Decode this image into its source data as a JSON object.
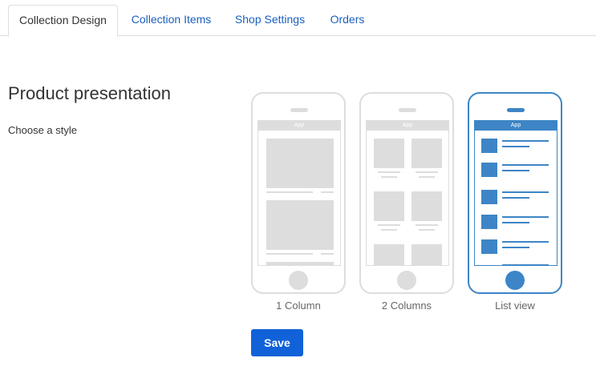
{
  "tabs": [
    {
      "label": "Collection Design",
      "active": true
    },
    {
      "label": "Collection Items",
      "active": false
    },
    {
      "label": "Shop Settings",
      "active": false
    },
    {
      "label": "Orders",
      "active": false
    }
  ],
  "section": {
    "title": "Product presentation",
    "subtitle": "Choose a style"
  },
  "styles": {
    "selected": "List view",
    "options": [
      {
        "label": "1 Column",
        "app_label": "App",
        "selected": false
      },
      {
        "label": "2 Columns",
        "app_label": "App",
        "selected": false
      },
      {
        "label": "List view",
        "app_label": "App",
        "selected": true
      }
    ]
  },
  "actions": {
    "save_label": "Save"
  },
  "colors": {
    "accent": "#3d85c6",
    "button": "#1162d8",
    "link": "#1a5fbf",
    "placeholder": "#dddddd"
  }
}
